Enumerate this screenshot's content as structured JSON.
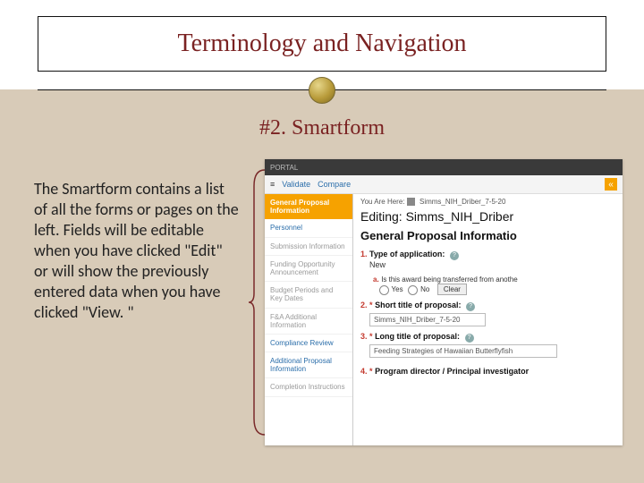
{
  "slide": {
    "title": "Terminology and Navigation",
    "subtitle": "#2. Smartform",
    "body": "The Smartform contains a list of all the forms or pages on the left.  Fields will be editable when you have clicked \"Edit\" or will show the previously entered data when you have clicked \"View. \""
  },
  "screenshot": {
    "topbar": "PORTAL",
    "toolbar": {
      "validate": "Validate",
      "compare": "Compare",
      "chevron": "«"
    },
    "nav": {
      "header": "General Proposal Information",
      "items": [
        {
          "label": "Personnel",
          "muted": false
        },
        {
          "label": "Submission Information",
          "muted": true
        },
        {
          "label": "Funding Opportunity Announcement",
          "muted": true
        },
        {
          "label": "Budget Periods and Key Dates",
          "muted": true
        },
        {
          "label": "F&A Additional Information",
          "muted": true
        },
        {
          "label": "Compliance Review",
          "muted": false
        },
        {
          "label": "Additional Proposal Information",
          "muted": false
        },
        {
          "label": "Completion Instructions",
          "muted": true
        }
      ]
    },
    "main": {
      "you_are_here": "You Are Here:",
      "crumb_value": "Simms_NIH_Driber_7-5-20",
      "editing_prefix": "Editing:",
      "editing_value": "Simms_NIH_Driber",
      "section_title": "General Proposal Informatio",
      "f1": {
        "num": "1.",
        "label": "Type of application:",
        "value": "New"
      },
      "f1a": {
        "num": "a.",
        "label": "Is this award being transferred from anothe",
        "yes": "Yes",
        "no": "No",
        "clear": "Clear"
      },
      "f2": {
        "num": "2.",
        "star": "*",
        "label": "Short title of proposal:",
        "value": "Simms_NIH_Driber_7-5-20"
      },
      "f3": {
        "num": "3.",
        "star": "*",
        "label": "Long title of proposal:",
        "value": "Feeding Strategies of Hawaiian Butterflyfish"
      },
      "f4": {
        "num": "4.",
        "star": "*",
        "label": "Program director / Principal investigator"
      }
    }
  }
}
